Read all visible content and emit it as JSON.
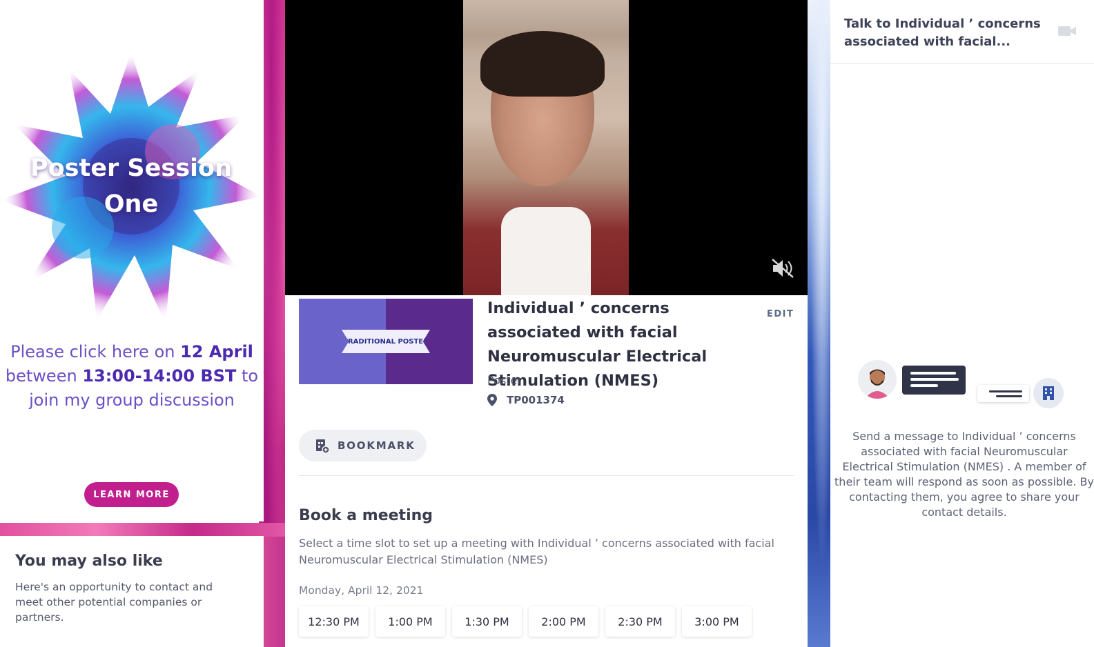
{
  "promo": {
    "title": "Poster Session One",
    "text_pre": "Please click here on ",
    "text_date": "12 April",
    "text_mid": " between ",
    "text_time": "13:00-14:00 BST",
    "text_post": " to join my group discussion",
    "learn_more": "LEARN MORE"
  },
  "also_like": {
    "title": "You may also like",
    "description": "Here's an opportunity to contact and meet other potential companies or partners."
  },
  "item": {
    "thumbnail_label": "TRADITIONAL POSTER",
    "title": "Individual ’ concerns associated with facial Neuromuscular Electrical Stimulation (NMES)",
    "edit": "EDIT",
    "type": "Poster",
    "location": "TP001374",
    "bookmark": "BOOKMARK"
  },
  "meeting": {
    "title": "Book a meeting",
    "description": "Select a time slot to set up a meeting with Individual ’ concerns associated with facial Neuromuscular Electrical Stimulation (NMES)",
    "date": "Monday, April 12, 2021",
    "slots": [
      "12:30 PM",
      "1:00 PM",
      "1:30 PM",
      "2:00 PM",
      "2:30 PM",
      "3:00 PM"
    ]
  },
  "chat": {
    "title": "Talk to Individual ’ concerns associated with facial...",
    "description": "Send a message to Individual ’ concerns associated with facial Neuromuscular Electrical Stimulation (NMES) . A member of their team will respond as soon as possible. By contacting them, you agree to share your contact details."
  },
  "colors": {
    "accent_magenta": "#c21f8e",
    "promo_text": "#6a4fc7",
    "dark_text": "#2f3142"
  },
  "icons": {
    "video_mute": "speaker-muted-icon",
    "location": "map-pin-icon",
    "bookmark": "calendar-bookmark-icon",
    "chat_video": "video-camera-icon",
    "company": "building-icon"
  }
}
